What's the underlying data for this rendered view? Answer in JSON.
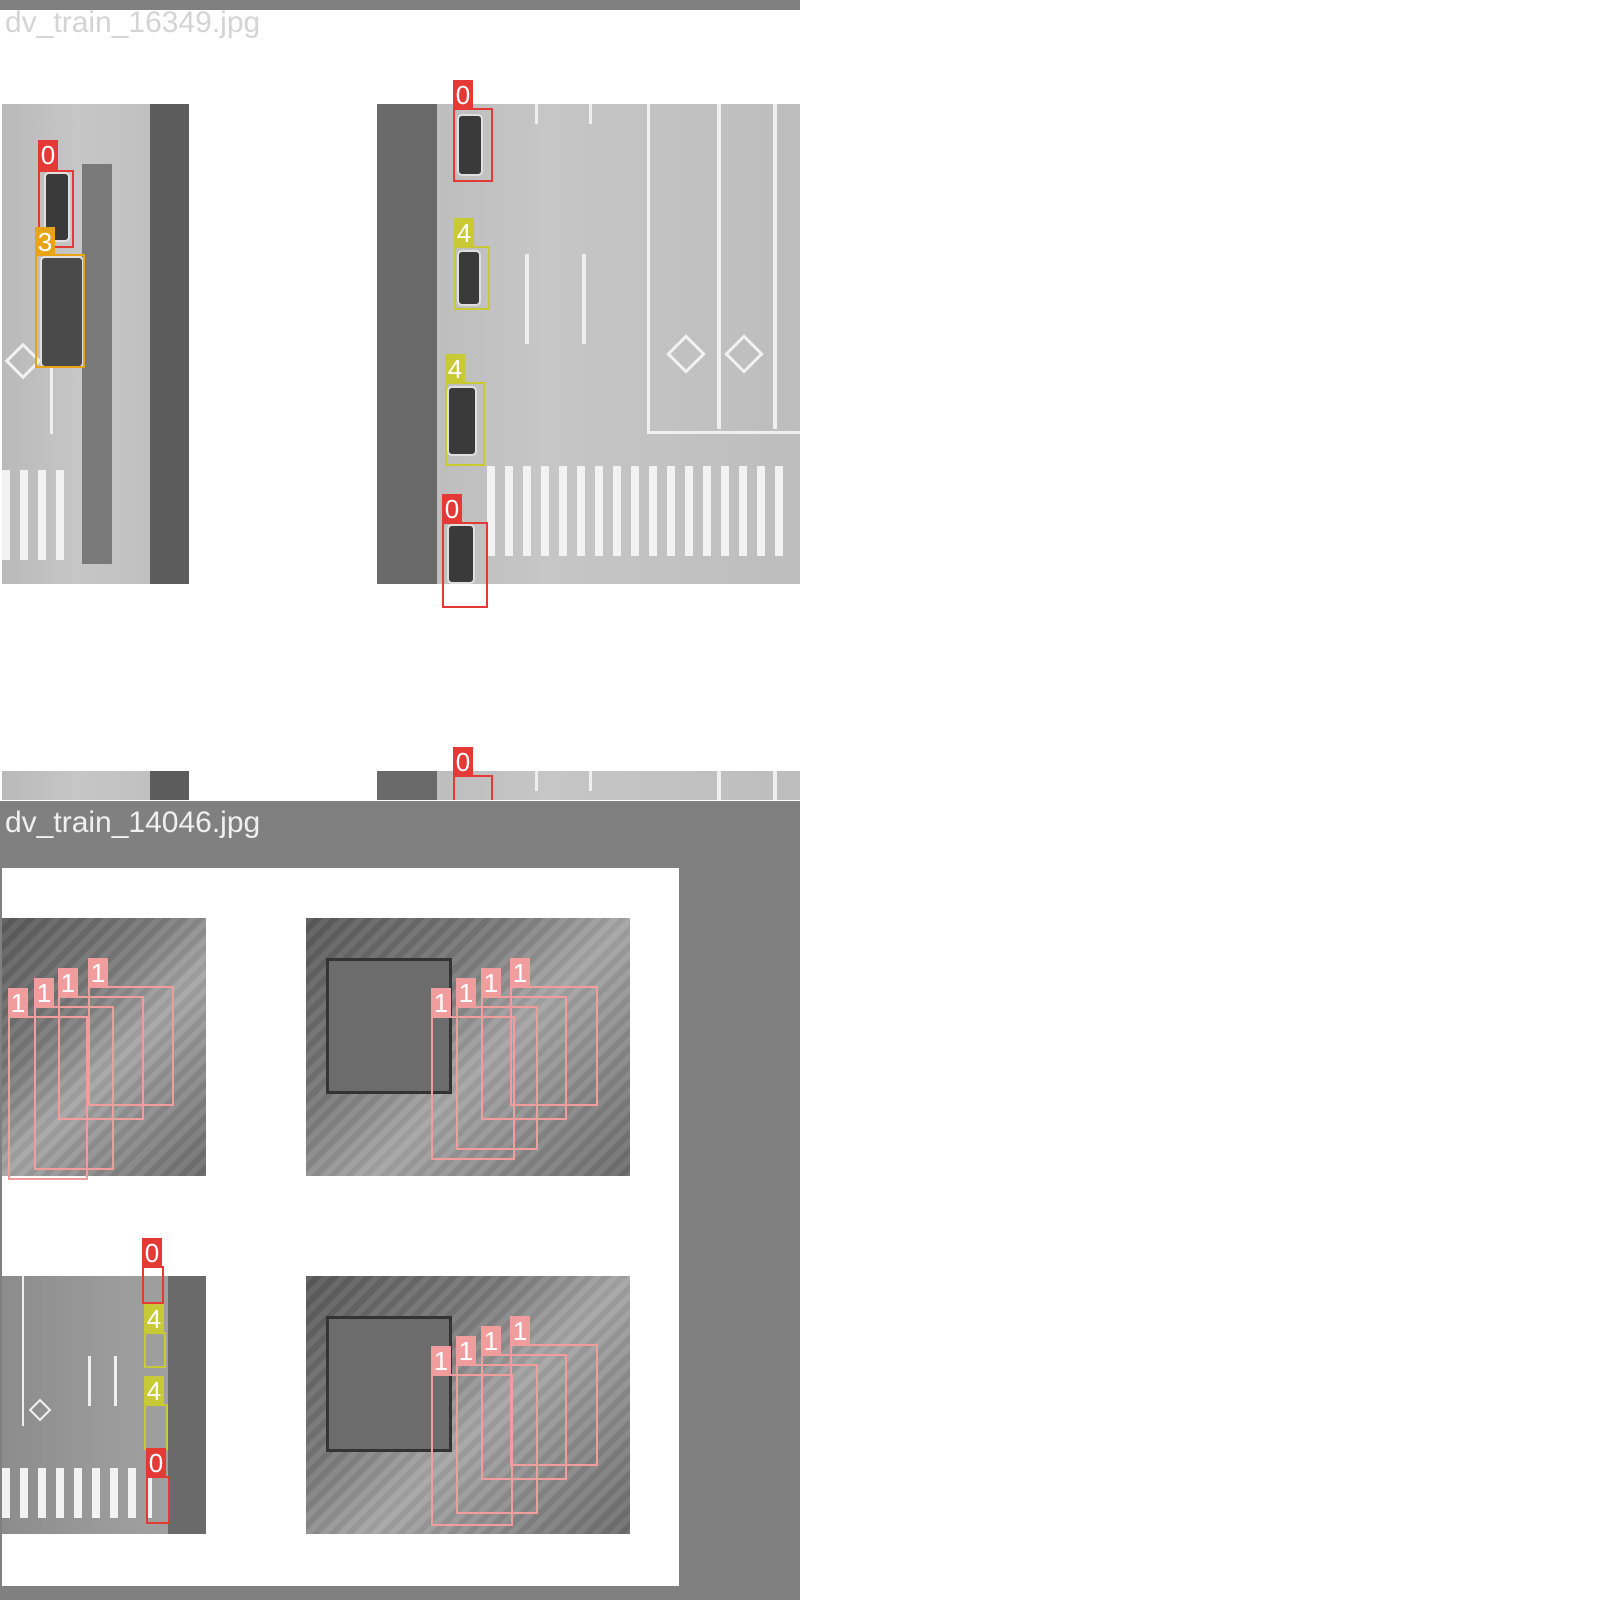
{
  "panels": [
    {
      "filename": "dv_train_16349.jpg"
    },
    {
      "filename": "dv_train_14046.jpg"
    }
  ],
  "classes": {
    "c0": {
      "id": "0",
      "color": "#e53935"
    },
    "c1": {
      "id": "1",
      "color": "#f29d9d"
    },
    "c3": {
      "id": "3",
      "color": "#e8a317"
    },
    "c4": {
      "id": "4",
      "color": "#c9c936"
    }
  },
  "colors": {
    "frame_gray": "#808080",
    "background": "#ffffff"
  }
}
